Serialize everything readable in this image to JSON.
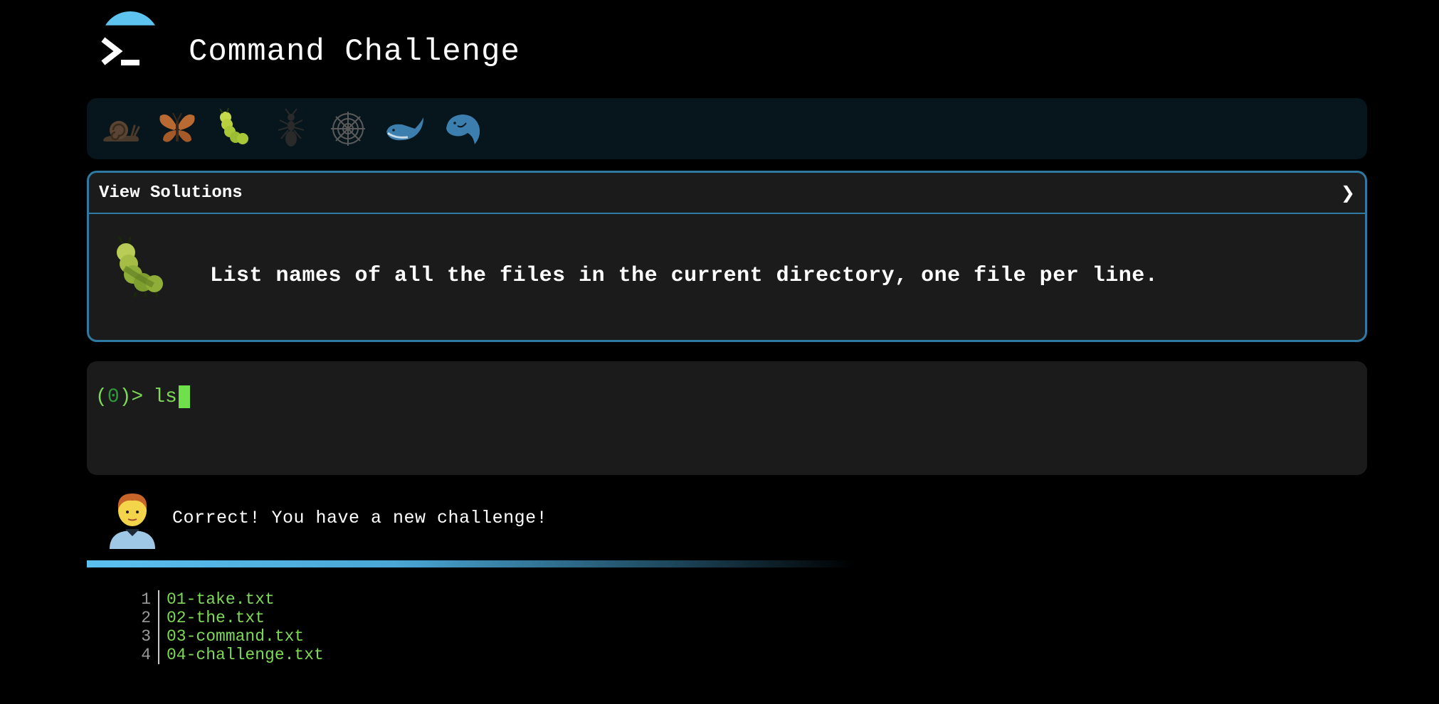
{
  "header": {
    "title": "Command Challenge",
    "logo_icon": "terminal-prompt-icon"
  },
  "levels": [
    {
      "name": "snail",
      "icon": "snail-icon"
    },
    {
      "name": "butterfly",
      "icon": "butterfly-icon"
    },
    {
      "name": "caterpillar",
      "icon": "caterpillar-icon"
    },
    {
      "name": "ant",
      "icon": "ant-icon"
    },
    {
      "name": "spider-web",
      "icon": "spider-web-icon"
    },
    {
      "name": "whale",
      "icon": "whale-icon"
    },
    {
      "name": "dolphin",
      "icon": "dolphin-icon"
    }
  ],
  "challenge": {
    "solutions_label": "View Solutions",
    "chevron": "❯",
    "text": "List names of all the files in the current directory, one file per line.",
    "icon": "caterpillar-icon"
  },
  "terminal": {
    "paren_open": "(",
    "count": "0",
    "paren_close": ")>",
    "command": "ls"
  },
  "feedback": {
    "avatar": "person-avatar-icon",
    "message": "Correct! You have a new challenge!"
  },
  "output": {
    "lines": [
      {
        "num": "1",
        "file": "01-take.txt"
      },
      {
        "num": "2",
        "file": "02-the.txt"
      },
      {
        "num": "3",
        "file": "03-command.txt"
      },
      {
        "num": "4",
        "file": "04-challenge.txt"
      }
    ]
  },
  "colors": {
    "accent": "#5fc3f0",
    "panel_border": "#2e7aa3",
    "terminal_green": "#7ed957",
    "background": "#000000"
  }
}
